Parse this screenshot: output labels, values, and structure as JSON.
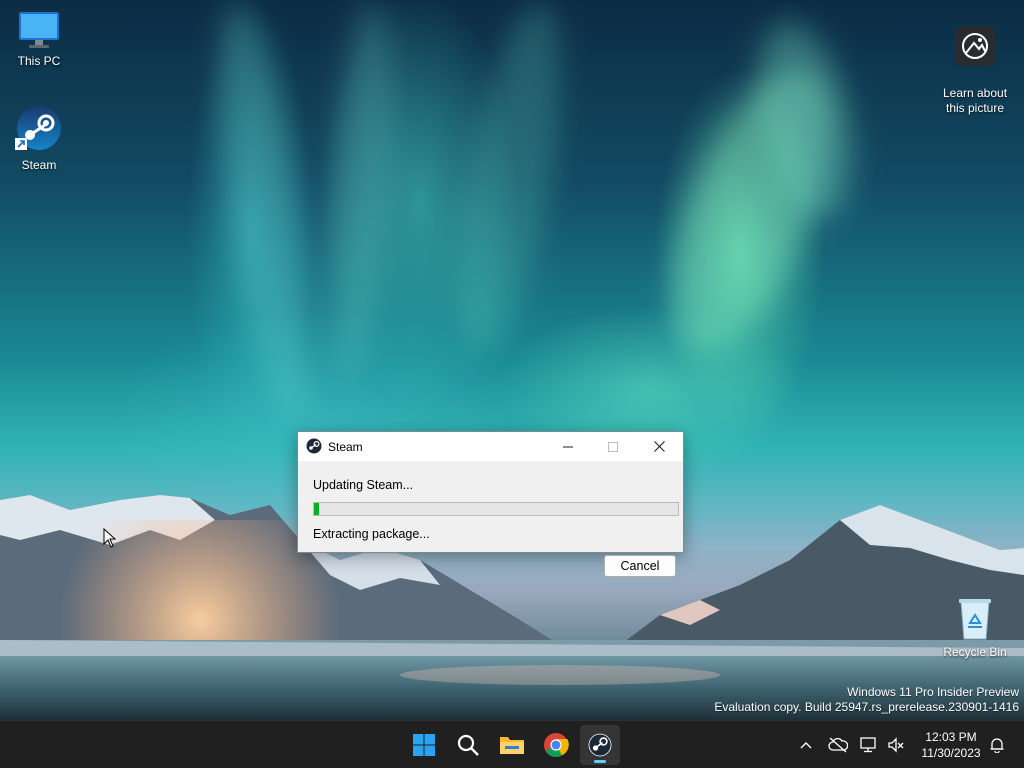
{
  "desktop": {
    "icons": [
      {
        "label": "This PC",
        "icon": "this-pc-icon"
      },
      {
        "label": "Steam",
        "icon": "steam-icon"
      },
      {
        "label": "Learn about\nthis picture",
        "icon": "learn-about-picture-icon"
      },
      {
        "label": "Recycle Bin",
        "icon": "recycle-bin-icon"
      }
    ],
    "watermark": {
      "line1": "Windows 11 Pro Insider Preview",
      "line2": "Evaluation copy. Build 25947.rs_prerelease.230901-1416"
    }
  },
  "dialog": {
    "title": "Steam",
    "status": "Updating Steam...",
    "progress": 0.015,
    "detail": "Extracting package...",
    "cancel_label": "Cancel",
    "progress_color": "#06b025"
  },
  "taskbar": {
    "apps": [
      {
        "name": "start",
        "icon": "windows-start-icon"
      },
      {
        "name": "search",
        "icon": "search-icon"
      },
      {
        "name": "file-explorer",
        "icon": "folder-icon"
      },
      {
        "name": "chrome",
        "icon": "chrome-icon"
      },
      {
        "name": "steam",
        "icon": "steam-icon",
        "active": true
      }
    ],
    "clock": {
      "time": "12:03 PM",
      "date": "11/30/2023"
    },
    "accent": "#60cdff"
  }
}
